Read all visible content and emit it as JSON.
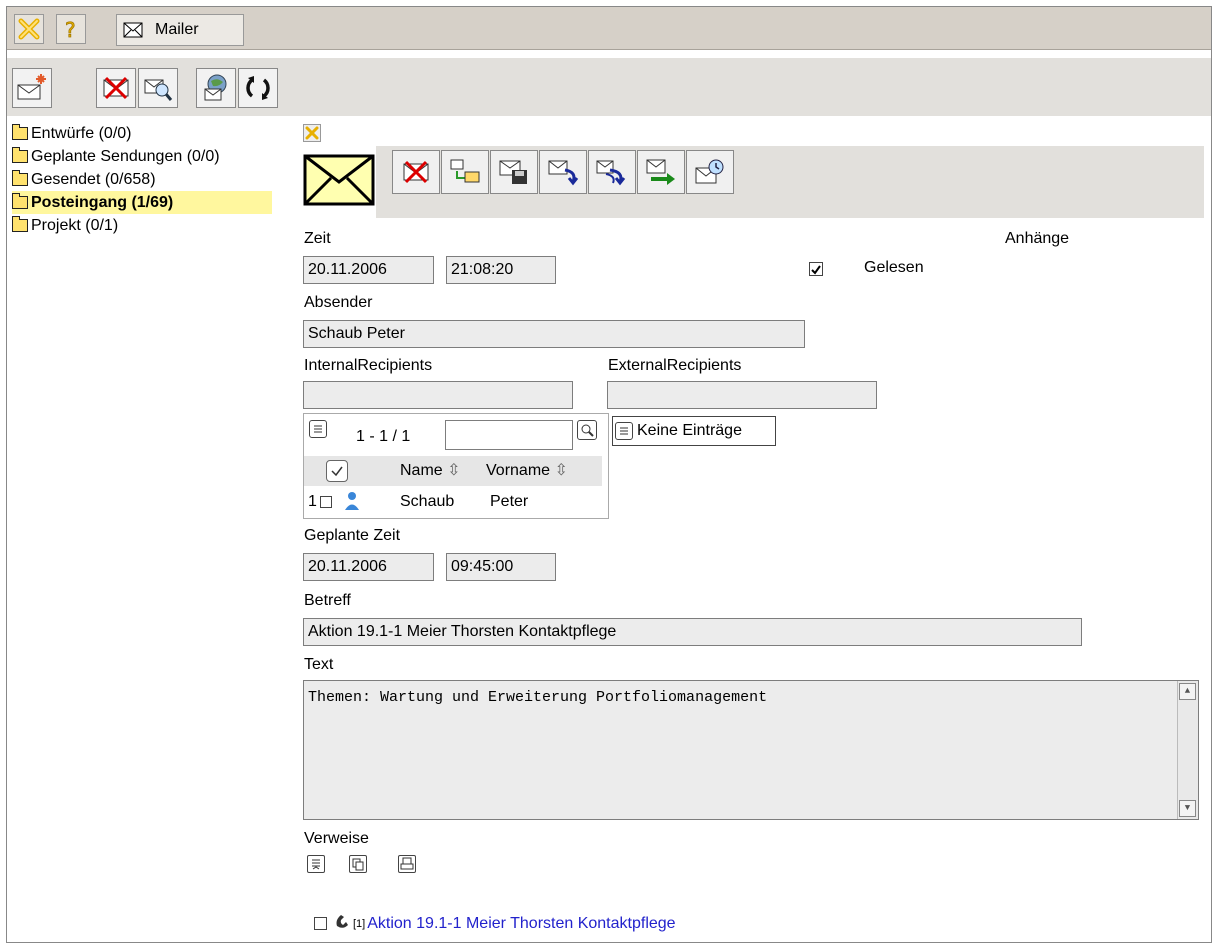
{
  "app": {
    "tab_label": "Mailer"
  },
  "folders": [
    {
      "label": "Entwürfe (0/0)",
      "active": false
    },
    {
      "label": "Geplante Sendungen (0/0)",
      "active": false
    },
    {
      "label": "Gesendet (0/658)",
      "active": false
    },
    {
      "label": "Posteingang (1/69)",
      "active": true
    },
    {
      "label": "Projekt (0/1)",
      "active": false
    }
  ],
  "message": {
    "time_label": "Zeit",
    "date": "20.11.2006",
    "time": "21:08:20",
    "attachments_label": "Anhänge",
    "read_label": "Gelesen",
    "read_checked": true,
    "sender_label": "Absender",
    "sender": "Schaub Peter",
    "internal_label": "InternalRecipients",
    "internal_value": "",
    "external_label": "ExternalRecipients",
    "external_value": "",
    "recipients_grid": {
      "paging": "1 - 1 / 1",
      "search_value": "",
      "col_name": "Name",
      "col_vorname": "Vorname",
      "rows": [
        {
          "index": "1",
          "name": "Schaub",
          "vorname": "Peter"
        }
      ]
    },
    "external_empty": "Keine Einträge",
    "planned_label": "Geplante Zeit",
    "planned_date": "20.11.2006",
    "planned_time": "09:45:00",
    "subject_label": "Betreff",
    "subject": "Aktion 19.1-1 Meier Thorsten Kontaktpflege",
    "text_label": "Text",
    "text": "Themen: Wartung und Erweiterung Portfoliomanagement",
    "references_label": "Verweise",
    "reference_index": "[1]",
    "reference_link": "Aktion 19.1-1 Meier Thorsten Kontaktpflege"
  },
  "colors": {
    "titlebar": "#d6d0c8",
    "toolbar": "#e2e0dc",
    "active_folder": "#fff79e",
    "link": "#2222cc"
  }
}
